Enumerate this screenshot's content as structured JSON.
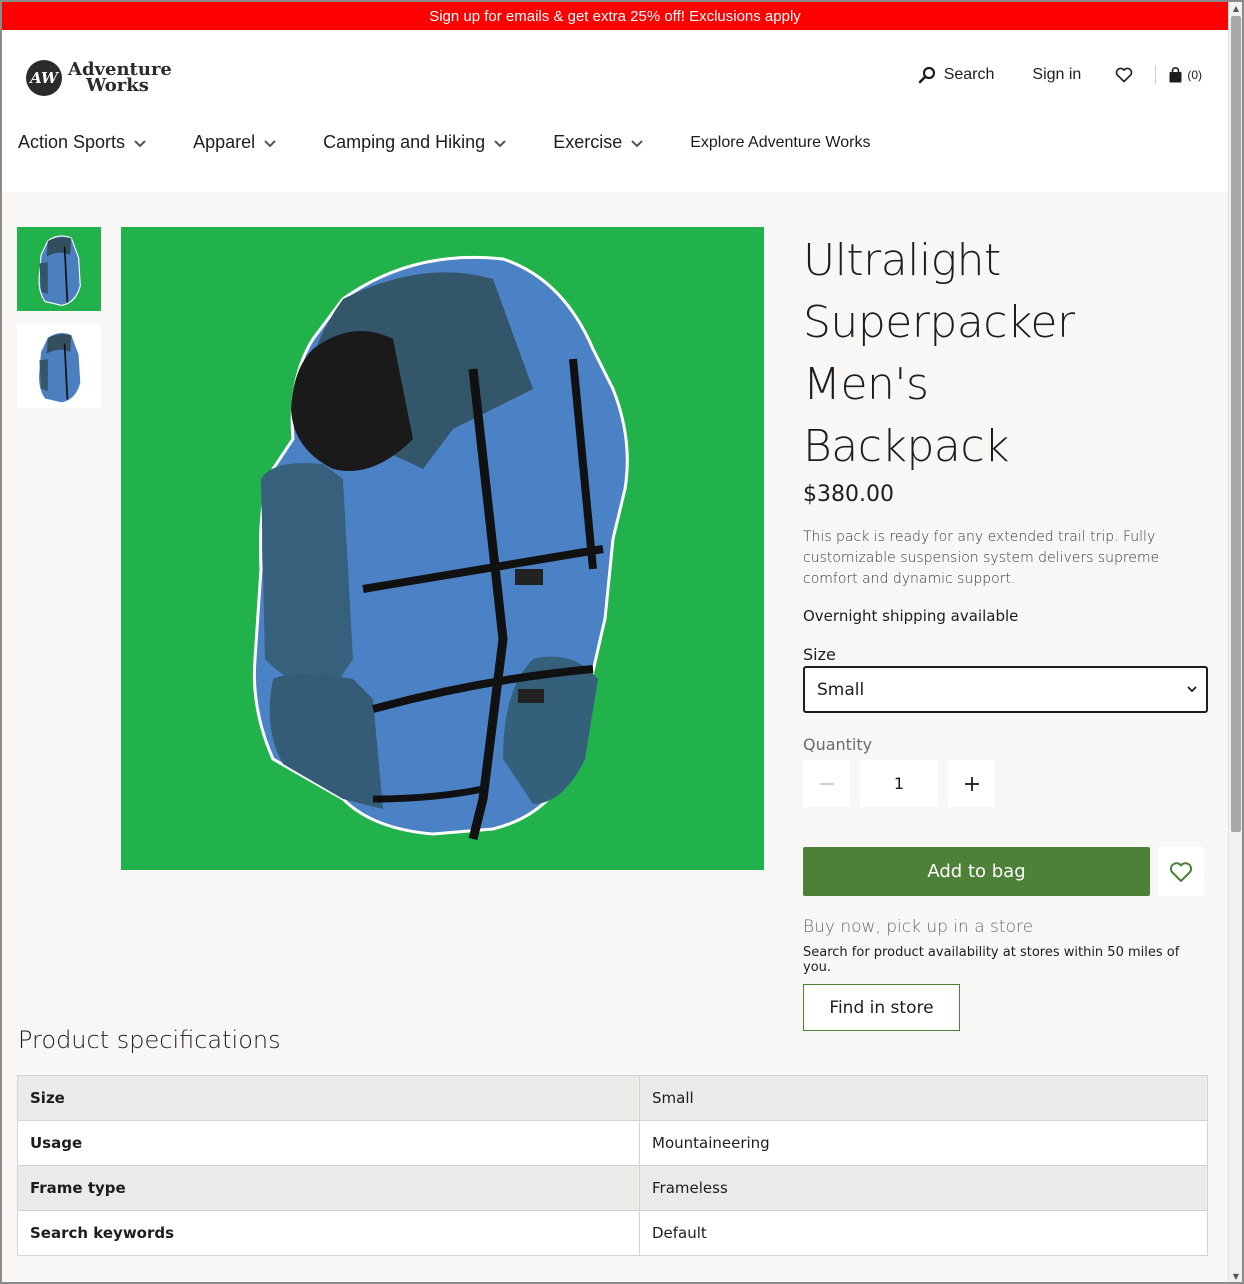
{
  "promo": {
    "text": "Sign up for emails & get extra 25% off! Exclusions apply"
  },
  "brand": {
    "badge": "AW",
    "line1": "Adventure",
    "line2": "Works"
  },
  "utility_nav": {
    "search_label": "Search",
    "signin_label": "Sign in",
    "cart_count": "(0)"
  },
  "categories": [
    {
      "label": "Action Sports",
      "has_menu": true
    },
    {
      "label": "Apparel",
      "has_menu": true
    },
    {
      "label": "Camping and Hiking",
      "has_menu": true
    },
    {
      "label": "Exercise",
      "has_menu": true
    },
    {
      "label": "Explore Adventure Works",
      "has_menu": false
    }
  ],
  "product": {
    "title_lines": [
      "Ultralight",
      "Superpacker Men's",
      "Backpack"
    ],
    "price": "$380.00",
    "description": "This pack is ready for any extended trail trip. Fully customizable suspension system delivers supreme comfort and dynamic support.",
    "shipping": "Overnight shipping available",
    "size_label": "Size",
    "size_selected": "Small",
    "quantity_label": "Quantity",
    "quantity_value": "1",
    "add_to_bag_label": "Add to bag",
    "pickup_title": "Buy now, pick up in a store",
    "pickup_subtitle": "Search for product availability at stores within 50 miles of you.",
    "find_in_store_label": "Find in store"
  },
  "specs": {
    "title": "Product specifications",
    "rows": [
      {
        "key": "Size",
        "value": "Small"
      },
      {
        "key": "Usage",
        "value": "Mountaineering"
      },
      {
        "key": "Frame type",
        "value": "Frameless"
      },
      {
        "key": "Search keywords",
        "value": "Default"
      }
    ]
  },
  "colors": {
    "promo_bg": "#ff0000",
    "image_bg": "#22b24c",
    "cta_green": "#4d8137"
  },
  "icons": {
    "search": "search-icon",
    "wishlist": "heart-icon",
    "cart": "shopping-bag-icon",
    "chevron": "chevron-down-icon"
  }
}
